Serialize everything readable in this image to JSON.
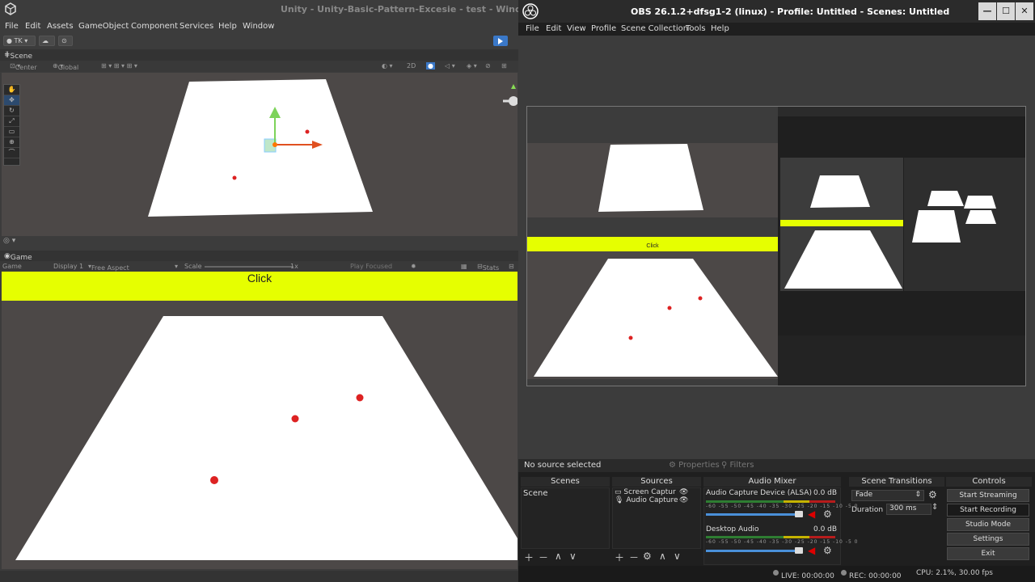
{
  "unity": {
    "title": "Unity - Unity-Basic-Pattern-Excesie - test - Windows,",
    "menu": [
      "File",
      "Edit",
      "Assets",
      "GameObject",
      "Component",
      "Services",
      "Help",
      "Window"
    ],
    "account": "TK",
    "scene_tab": "Scene",
    "pivot": "Center",
    "space": "Global",
    "mode_2d": "2D",
    "game_tab": "Game",
    "game_label": "Game",
    "display": "Display 1",
    "aspect": "Free Aspect",
    "scale_label": "Scale",
    "scale_value": "1x",
    "play_focused": "Play Focused",
    "stats": "Stats",
    "gizmos": "Gizmos",
    "click_button": "Click"
  },
  "obs": {
    "title": "OBS 26.1.2+dfsg1-2 (linux) - Profile: Untitled - Scenes: Untitled",
    "menu": [
      "File",
      "Edit",
      "View",
      "Profile",
      "Scene Collection",
      "Tools",
      "Help"
    ],
    "no_source": "No source selected",
    "properties": "Properties",
    "filters": "Filters",
    "docks": {
      "scenes": "Scenes",
      "sources": "Sources",
      "mixer": "Audio Mixer",
      "transitions": "Scene Transitions",
      "controls": "Controls"
    },
    "scene_item": "Scene",
    "sources": [
      "Screen Captur",
      "Audio Capture"
    ],
    "audio": [
      {
        "name": "Audio Capture Device (ALSA)",
        "level": "0.0 dB",
        "fader": 0.9
      },
      {
        "name": "Desktop Audio",
        "level": "0.0 dB",
        "fader": 0.9
      }
    ],
    "meter_ticks": "-60 -55 -50 -45 -40 -35 -30 -25 -20 -15 -10 -5 0",
    "transition": "Fade",
    "duration_label": "Duration",
    "duration_value": "300 ms",
    "controls": [
      "Start Streaming",
      "Start Recording",
      "Studio Mode",
      "Settings",
      "Exit"
    ],
    "status": {
      "live": "LIVE: 00:00:00",
      "rec": "REC: 00:00:00",
      "cpu": "CPU: 2.1%, 30.00 fps"
    },
    "nested_click": "Click"
  }
}
